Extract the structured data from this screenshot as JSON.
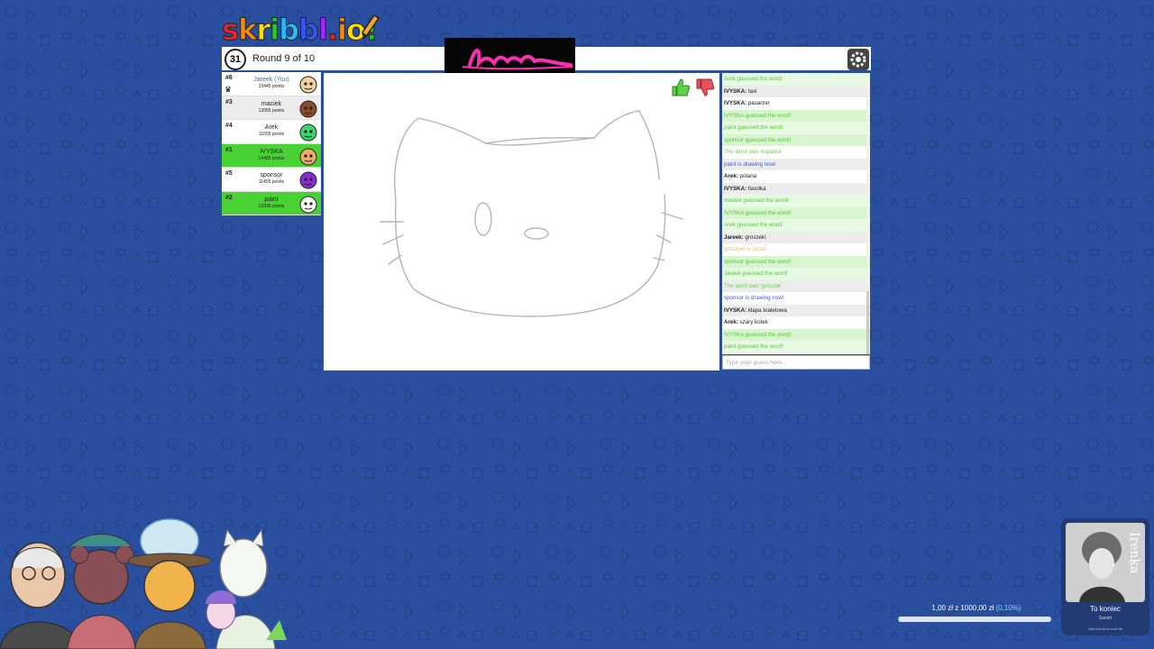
{
  "logo": {
    "letters": [
      "s",
      "k",
      "r",
      "i",
      "b",
      "b",
      "l",
      ".",
      "i",
      "o",
      "!"
    ],
    "colors": [
      "#e22",
      "#f80",
      "#fd0",
      "#2c2",
      "#2bf",
      "#35f",
      "#a2f",
      "#e22",
      "#f80",
      "#fd0",
      "#2c2"
    ]
  },
  "header": {
    "timer": "31",
    "round_text": "Round 9 of 10"
  },
  "players": [
    {
      "rank": "#6",
      "name": "Jareek (You)",
      "points": "10445 points",
      "you": true,
      "guessed": false,
      "crown": true,
      "avatar_color": "#f2d29c"
    },
    {
      "rank": "#3",
      "name": "maciek",
      "points": "12055 points",
      "you": false,
      "guessed": false,
      "crown": false,
      "avatar_color": "#8b4a2b"
    },
    {
      "rank": "#4",
      "name": "Arek",
      "points": "11555 points",
      "you": false,
      "guessed": false,
      "crown": false,
      "avatar_color": "#3bd46b"
    },
    {
      "rank": "#1",
      "name": "IVYSKA",
      "points": "14485 points",
      "you": false,
      "guessed": true,
      "crown": false,
      "avatar_color": "#f0a86b"
    },
    {
      "rank": "#5",
      "name": "sponsor",
      "points": "11455 points",
      "you": false,
      "guessed": false,
      "crown": false,
      "avatar_color": "#8a2bd6"
    },
    {
      "rank": "#2",
      "name": "paint",
      "points": "13335 points",
      "you": false,
      "guessed": true,
      "crown": false,
      "avatar_color": "#ffffff"
    }
  ],
  "chat": [
    {
      "text": "Arek guessed the word!",
      "type": "green"
    },
    {
      "user": "IVYSKA:",
      "text": " taxi",
      "type": "normal"
    },
    {
      "user": "IVYSKA:",
      "text": " pasarzer",
      "type": "normal"
    },
    {
      "text": "IVYSKA guessed the word!",
      "type": "green"
    },
    {
      "text": "paint guessed the word!",
      "type": "green"
    },
    {
      "text": "sponsor guessed the word!",
      "type": "green"
    },
    {
      "text": "The word was 'koparka'",
      "type": "lime"
    },
    {
      "text": "paint is drawing now!",
      "type": "blue"
    },
    {
      "user": "Arek:",
      "text": " polana",
      "type": "normal"
    },
    {
      "user": "IVYSKA:",
      "text": " fasolka",
      "type": "normal"
    },
    {
      "text": "maciek guessed the word!",
      "type": "green"
    },
    {
      "text": "IVYSKA guessed the word!",
      "type": "green"
    },
    {
      "text": "Arek guessed the word!",
      "type": "green"
    },
    {
      "user": "Jareek:",
      "text": " groszek\\",
      "type": "normal"
    },
    {
      "text": "groszek\\ is close!",
      "type": "orange"
    },
    {
      "text": "sponsor guessed the word!",
      "type": "green"
    },
    {
      "text": "Jareek guessed the word!",
      "type": "green"
    },
    {
      "text": "The word was 'groszek'",
      "type": "lime"
    },
    {
      "text": "sponsor is drawing now!",
      "type": "blue"
    },
    {
      "user": "IVYSKA:",
      "text": " klapa toaletowa",
      "type": "normal"
    },
    {
      "user": "Arek:",
      "text": " szary kotek",
      "type": "normal"
    },
    {
      "text": "IVYSKA guessed the word!",
      "type": "green"
    },
    {
      "text": "paint guessed the word!",
      "type": "green"
    }
  ],
  "chat_input": {
    "placeholder": "Type your guess here..."
  },
  "donation": {
    "text": "1,00 zł z 1000,00 zł",
    "percent_text": "(0,10%)",
    "fraction": 0.001
  },
  "music": {
    "cover_word": "Irenka",
    "title": "To koniec",
    "artist": "Sanah",
    "subtitle": "Visit info from Last.fm"
  },
  "icons": {
    "settings": "gear-icon",
    "like": "thumbs-up-icon",
    "dislike": "thumbs-down-icon",
    "timer": "alarm-clock-icon",
    "crown": "crown-icon"
  }
}
